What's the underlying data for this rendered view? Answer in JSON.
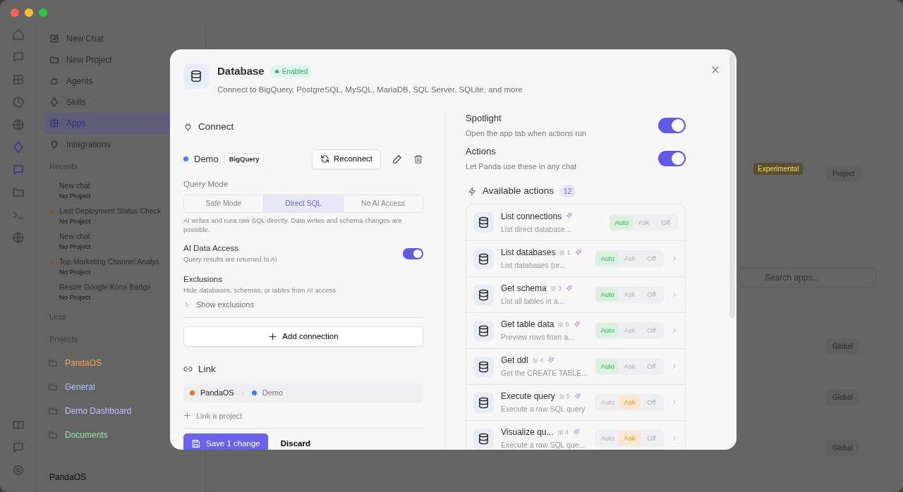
{
  "sidebar": {
    "nav": [
      {
        "label": "New Chat",
        "selected": false
      },
      {
        "label": "New Project",
        "selected": false
      },
      {
        "label": "Agents",
        "selected": false
      },
      {
        "label": "Skills",
        "selected": false
      },
      {
        "label": "Apps",
        "selected": true
      },
      {
        "label": "Integrations",
        "selected": false
      }
    ],
    "recents_title": "Recents",
    "recents": [
      {
        "title": "New chat",
        "subtitle": "No Project",
        "starred": false
      },
      {
        "title": "Last Deployment Status Check",
        "subtitle": "No Project",
        "starred": true
      },
      {
        "title": "New chat",
        "subtitle": "No Project",
        "starred": false
      },
      {
        "title": "Top Marketing Channel Analys",
        "subtitle": "No Project",
        "starred": true
      },
      {
        "title": "Resize Google Kona Badge",
        "subtitle": "No Project",
        "starred": false
      }
    ],
    "more": "Less",
    "projects_title": "Projects",
    "projects": [
      {
        "name": "PandaOS",
        "color": "#f5a25a"
      },
      {
        "name": "General",
        "color": "#a9c4ff"
      },
      {
        "name": "Demo Dashboard",
        "color": "#c4c0ff"
      },
      {
        "name": "Documents",
        "color": "#9be0b0"
      }
    ],
    "workspace": "PandaOS"
  },
  "background": {
    "experimental_tag": "Experimental",
    "project_button": "Project",
    "search": {
      "placeholder": "Search apps..."
    },
    "scope_buttons": [
      "Global",
      "Global",
      "Global"
    ]
  },
  "modal": {
    "title": "Database",
    "status": {
      "label": "Enabled",
      "enabled": true
    },
    "subtitle": "Connect to BigQuery, PostgreSQL, MySQL, MariaDB, SQL Server, SQLite, and more",
    "connect": {
      "heading": "Connect",
      "connection": {
        "name": "Demo",
        "color": "#3b82f6",
        "type": "BigQuery",
        "reconnect": "Reconnect"
      },
      "query_mode_label": "Query Mode",
      "modes": [
        {
          "label": "Safe Mode",
          "selected": false
        },
        {
          "label": "Direct SQL",
          "selected": true
        },
        {
          "label": "No AI Access",
          "selected": false
        }
      ],
      "mode_help": "AI writes and runs raw SQL directly. Data writes and schema changes are possible.",
      "ai_access": {
        "title": "AI Data Access",
        "description": "Query results are returned to AI",
        "on": true
      },
      "exclusions": {
        "title": "Exclusions",
        "description": "Hide databases, schemas, or tables from AI access",
        "toggle": "Show exclusions",
        "expanded": false
      },
      "add_button": "Add connection"
    },
    "link": {
      "heading": "Link",
      "path": [
        {
          "label": "PandaOS",
          "color": "#e8741c"
        },
        {
          "label": "Demo",
          "color": "#3b82f6"
        }
      ],
      "add": "Link a project"
    },
    "footer": {
      "save": "Save 1 change",
      "discard": "Discard"
    },
    "settings": [
      {
        "title": "Spotlight",
        "description": "Open the app tab when actions run",
        "on": true
      },
      {
        "title": "Actions",
        "description": "Let Panda use these in any chat",
        "on": true
      }
    ],
    "actions_heading": "Available actions",
    "actions_count": "12",
    "actions": [
      {
        "name": "List connections",
        "description": "List direct database...",
        "expandable": false,
        "modes": [
          {
            "label": "Auto",
            "selected": true
          },
          {
            "label": "Ask",
            "selected": false
          },
          {
            "label": "Off",
            "selected": false
          }
        ]
      },
      {
        "name": "List databases",
        "params": "1",
        "description": "List databases (or...",
        "expandable": true,
        "modes": [
          {
            "label": "Auto",
            "selected": true
          },
          {
            "label": "Ask",
            "selected": false
          },
          {
            "label": "Off",
            "selected": false
          }
        ]
      },
      {
        "name": "Get schema",
        "params": "3",
        "description": "List all tables in a...",
        "expandable": true,
        "modes": [
          {
            "label": "Auto",
            "selected": true
          },
          {
            "label": "Ask",
            "selected": false
          },
          {
            "label": "Off",
            "selected": false
          }
        ]
      },
      {
        "name": "Get table data",
        "params": "5",
        "description": "Preview rows from a...",
        "expandable": true,
        "modes": [
          {
            "label": "Auto",
            "selected": true
          },
          {
            "label": "Ask",
            "selected": false
          },
          {
            "label": "Off",
            "selected": false
          }
        ]
      },
      {
        "name": "Get ddl",
        "params": "4",
        "description": "Get the CREATE TABLE...",
        "expandable": true,
        "modes": [
          {
            "label": "Auto",
            "selected": true
          },
          {
            "label": "Ask",
            "selected": false
          },
          {
            "label": "Off",
            "selected": false
          }
        ]
      },
      {
        "name": "Execute query",
        "params": "5",
        "description": "Execute a raw SQL query",
        "expandable": true,
        "modes": [
          {
            "label": "Auto",
            "selected": false
          },
          {
            "label": "Ask",
            "selected": true
          },
          {
            "label": "Off",
            "selected": false
          }
        ]
      },
      {
        "name": "Visualize qu...",
        "params": "4",
        "description": "Execute a raw SQL que...",
        "expandable": true,
        "modes": [
          {
            "label": "Auto",
            "selected": false
          },
          {
            "label": "Ask",
            "selected": true
          },
          {
            "label": "Off",
            "selected": false
          }
        ]
      }
    ]
  }
}
